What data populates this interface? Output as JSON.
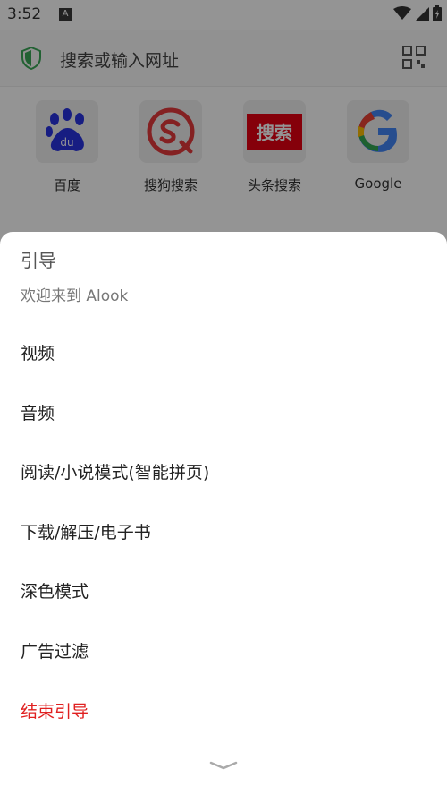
{
  "status_bar": {
    "time": "3:52",
    "app_badge": "A"
  },
  "address_bar": {
    "placeholder": "搜索或输入网址"
  },
  "shortcuts": [
    {
      "label": "百度",
      "icon": "baidu-logo-icon"
    },
    {
      "label": "搜狗搜索",
      "icon": "sogou-logo-icon"
    },
    {
      "label": "头条搜索",
      "icon": "toutiao-search-logo-icon",
      "badge_text": "搜索"
    },
    {
      "label": "Google",
      "icon": "google-logo-icon",
      "badge_text": "G"
    }
  ],
  "sheet": {
    "title": "引导",
    "subtitle": "欢迎来到 Alook",
    "items": [
      {
        "label": "视频"
      },
      {
        "label": "音频"
      },
      {
        "label": "阅读/小说模式(智能拼页)"
      },
      {
        "label": "下载/解压/电子书"
      },
      {
        "label": "深色模式"
      },
      {
        "label": "广告过滤"
      },
      {
        "label": "结束引导",
        "color": "#e02020"
      }
    ]
  },
  "colors": {
    "accent_green": "#3aa757",
    "danger": "#e02020",
    "scrim": "#000000"
  }
}
